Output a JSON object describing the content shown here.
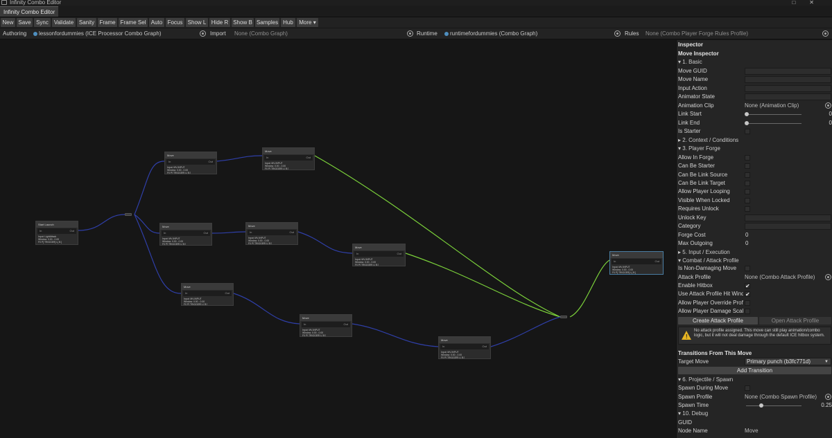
{
  "window": {
    "title": "Infinity Combo Editor"
  },
  "tab": {
    "label": "Infinity Combo Editor"
  },
  "toolbar": {
    "buttons": [
      "New",
      "Save",
      "Sync",
      "Validate",
      "Sanity",
      "Frame",
      "Frame Sel",
      "Auto",
      "Focus",
      "Show L",
      "Hide R",
      "Show B",
      "Samples",
      "Hub",
      "More ▾"
    ]
  },
  "assetbar": {
    "authoring_label": "Authoring",
    "authoring_value": "lessonfordummies (ICE Processor Combo Graph)",
    "import_label": "Import",
    "import_value": "None (Combo Graph)",
    "runtime_label": "Runtime",
    "runtime_value": "runtimefordummies (Combo Graph)",
    "rules_label": "Rules",
    "rules_value": "None (Combo Player Forge Rules Profile)"
  },
  "graph": {
    "nodes": [
      {
        "title": "Start Launch",
        "in": "In",
        "out": "Out",
        "info": "Input: LightAttack\nWindow: 0.00 - 0.00\nF0 P[ TRIGGER] L[ B ]\nF0|D0|F0|G0 B0|H0 N0 BT|TRG S0|C0|CR FG"
      },
      {
        "title": "Move",
        "in": "In",
        "out": "Out",
        "info": "Input: MV-INPUT\nWindow: 0.00 - 0.00\nF0 P[ TRIGGER] L[ B ]\nF0 P[ P] B[ B] H0 R0 B0 C|T CRIT P C E|ORF FG"
      },
      {
        "title": "Move",
        "in": "In",
        "out": "Out",
        "info": "Input: MV-INPUT\nWindow: 0.00 - 0.00\nF0 P[ TRIGGER] L[ B ]\nF0 P[ P] B[ B] H0 R0 B0 C|T CRIT P C E|ORF FG"
      },
      {
        "title": "Move",
        "in": "In",
        "out": "Out",
        "info": "Input: MV-INPUT\nWindow: 0.00 - 0.00\nF0 P[ TRIGGER] L[ B ]\nF0 P[ P] B[ B] H0 R0 B0 C|T CRIT P C E|ORF FG"
      },
      {
        "title": "Move",
        "in": "In",
        "out": "Out",
        "info": "Input: MV-INPUT\nWindow: 0.00 - 0.00\nF0 P[ TRIGGER] L[ B ]\nF0 P[ P] B[ B] H0 R0 B0 C|T CRIT P C E|ORF FG"
      },
      {
        "title": "Move",
        "in": "In",
        "out": "Out",
        "info": "Input: MV-INPUT\nWindow: 0.00 - 0.00\nF0 P[ TRIGGER] L[ B ]\nF0 P[ P] B[ B] H0 R0 B0 C|T CRIT P C E|ORF FG"
      },
      {
        "title": "Move",
        "in": "In",
        "out": "Out",
        "info": "Input: MV-INPUT\nWindow: 0.00 - 0.00\nF0 P[ TRIGGER] L[ B ]\nF0 P[ P] B[ B] H0 R0 B0 C|T CRIT P C E|ORF FG"
      },
      {
        "title": "Move",
        "in": "In",
        "out": "Out",
        "info": "Input: MV-INPUT\nWindow: 0.00 - 0.00\nF0 P[ TRIGGER] L[ B ]\nF0 P[ P] B[ B] H0 R0 B0 C|T CRIT P C E|ORF FG"
      },
      {
        "title": "Move",
        "in": "In",
        "out": "Out",
        "info": "Input: MV-INPUT\nWindow: 0.00 - 0.00\nF0 P[ TRIGGER] L[ B ]\nF0 P[ P] B[ B] H0 R0 B0 C|T CRIT P C E|ORF FG"
      },
      {
        "title": "Move",
        "in": "In",
        "out": "Out",
        "info": "Input: MV-INPUT\nWindow: 0.00 - 0.00\nF0 P[ TRIGGER] L[ B ]\nF0 P[ P] B[ B] H0 R0 B0 C|T CRIT P C E|ORF FG"
      }
    ],
    "colors": {
      "edge_blue": "#2f3fa8",
      "edge_green": "#7bd13a",
      "selected": "#4a7ea3"
    }
  },
  "inspector": {
    "header": "Inspector",
    "title": "Move Inspector",
    "basic": "1. Basic",
    "move_guid": "Move GUID",
    "move_name": "Move Name",
    "input_action": "Input Action",
    "animator_state": "Animator State",
    "animation_clip": "Animation Clip",
    "animation_clip_value": "None (Animation Clip)",
    "link_start": "Link Start",
    "link_start_value": "0",
    "link_end": "Link End",
    "link_end_value": "0",
    "is_starter": "Is Starter",
    "context": "2. Context / Conditions",
    "player_forge": "3. Player Forge",
    "allow_in_forge": "Allow In Forge",
    "can_be_starter": "Can Be Starter",
    "can_be_link_source": "Can Be Link Source",
    "can_be_link_target": "Can Be Link Target",
    "allow_player_looping": "Allow Player Looping",
    "visible_when_locked": "Visible When Locked",
    "requires_unlock": "Requires Unlock",
    "unlock_key": "Unlock Key",
    "category": "Category",
    "forge_cost": "Forge Cost",
    "forge_cost_value": "0",
    "max_outgoing": "Max Outgoing",
    "max_outgoing_value": "0",
    "input_execution": "5. Input / Execution",
    "combat_attack": "Combat / Attack Profile",
    "is_non_damaging": "Is Non-Damaging Move",
    "attack_profile": "Attack Profile",
    "attack_profile_value": "None (Combo Attack Profile)",
    "enable_hitbox": "Enable Hitbox",
    "use_attack_profile_hit": "Use Attack Profile Hit Window",
    "allow_player_override": "Allow Player Override Profile",
    "allow_player_damage": "Allow Player Damage Scaling",
    "create_attack_profile": "Create Attack Profile",
    "open_attack_profile": "Open Attack Profile",
    "help_text": "No attack profile assigned. This move can still play animation/combo logic, but it will not deal damage through the default ICE hitbox system.",
    "transitions_header": "Transitions From This Move",
    "target_move": "Target Move",
    "target_move_value": "Primary punch (b3fc771d)",
    "add_transition": "Add Transition",
    "projectile_spawn": "6. Projectile / Spawn",
    "spawn_during_move": "Spawn During Move",
    "spawn_profile": "Spawn Profile",
    "spawn_profile_value": "None (Combo Spawn Profile)",
    "spawn_time": "Spawn Time",
    "spawn_time_value": "0.25",
    "debug": "10. Debug",
    "guid": "GUID",
    "node_name": "Node Name",
    "node_name_value": "Move",
    "check_mark": "✔",
    "expanded_marker": "▾",
    "collapsed_marker": "▸"
  }
}
